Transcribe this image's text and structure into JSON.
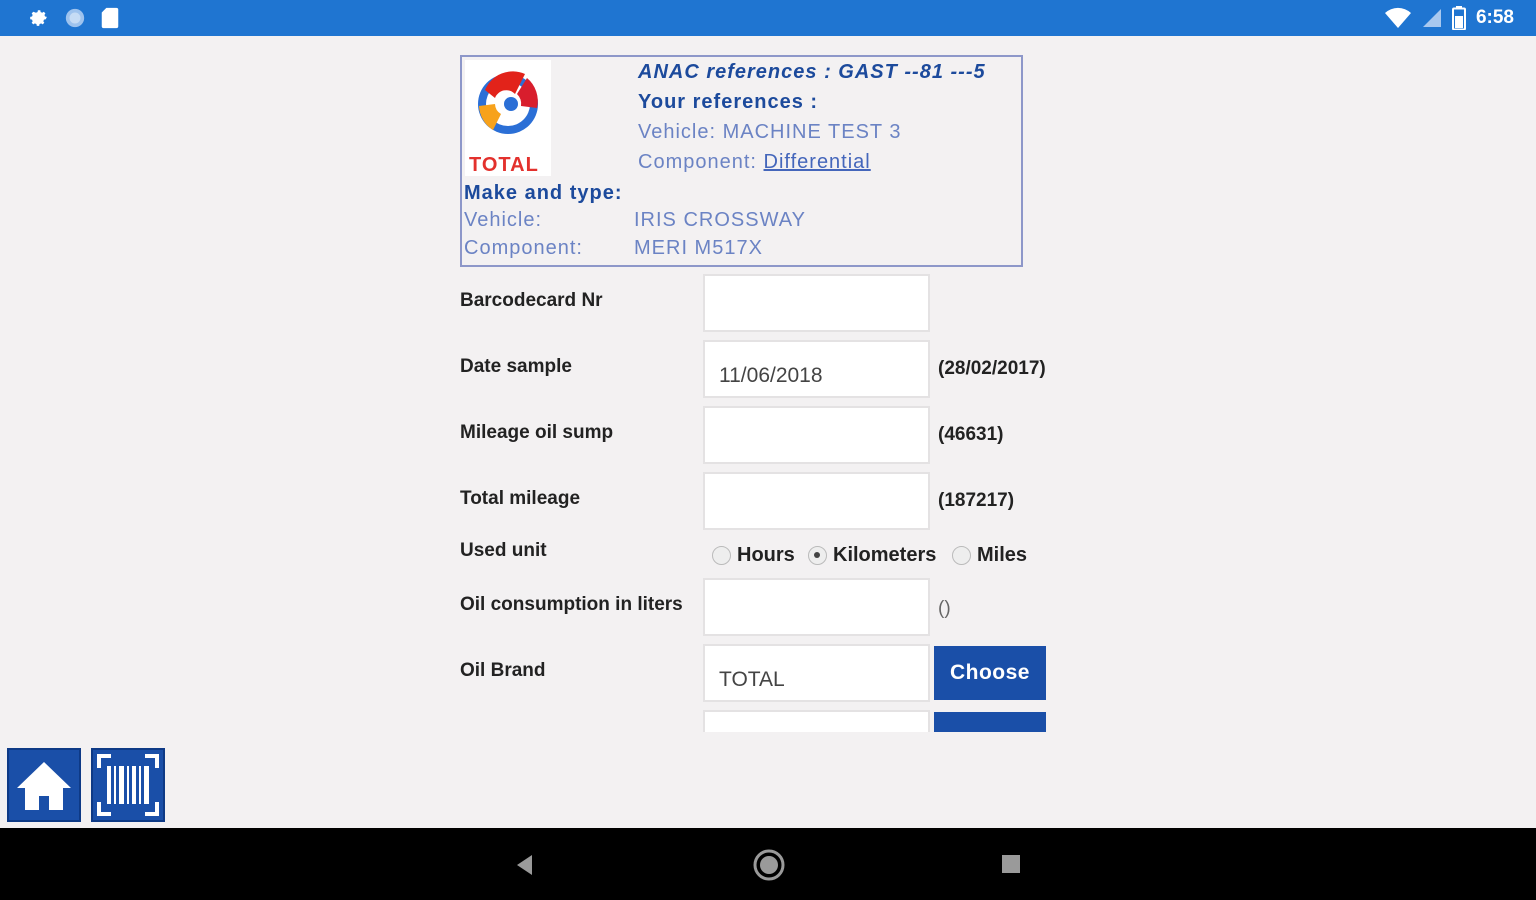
{
  "status_bar": {
    "time": "6:58",
    "left_icons": [
      "settings-icon",
      "sync-icon",
      "sd-card-icon"
    ],
    "right_icons": [
      "wifi-icon",
      "signal-icon",
      "battery-icon"
    ],
    "color": "#1f75d1"
  },
  "references": {
    "logo_text": "TOTAL",
    "anac": "ANAC references : GAST --81 ---5",
    "your_references": "Your references :",
    "vehicle": "Vehicle: MACHINE TEST 3",
    "component_label": "Component: ",
    "component_link": "Differential",
    "make_type_title": "Make and type:",
    "make_vehicle_label": "Vehicle:",
    "make_vehicle_value": "IRIS CROSSWAY",
    "make_component_label": "Component:",
    "make_component_value": "MERI M517X"
  },
  "form": {
    "barcode_label": "Barcodecard Nr",
    "barcode_value": "",
    "date_label": "Date sample",
    "date_value": "11/06/2018",
    "date_hint": "(28/02/2017)",
    "mileage_label": "Mileage oil sump",
    "mileage_value": "",
    "mileage_hint": "(46631)",
    "total_label": "Total mileage",
    "total_value": "",
    "total_hint": "(187217)",
    "unit_label": "Used unit",
    "unit_options": [
      "Hours",
      "Kilometers",
      "Miles"
    ],
    "unit_selected": "Kilometers",
    "oil_cons_label": "Oil consumption in liters",
    "oil_cons_value": "",
    "oil_cons_hint": "()",
    "brand_label": "Oil  Brand",
    "brand_value": "TOTAL",
    "choose_label": "Choose"
  },
  "toolbar": {
    "home_icon": "home-icon",
    "scan_icon": "barcode-scan-icon",
    "accent": "#1a4fa8"
  },
  "nav": {
    "icons": [
      "back-icon",
      "home-circle-icon",
      "recents-icon"
    ]
  }
}
